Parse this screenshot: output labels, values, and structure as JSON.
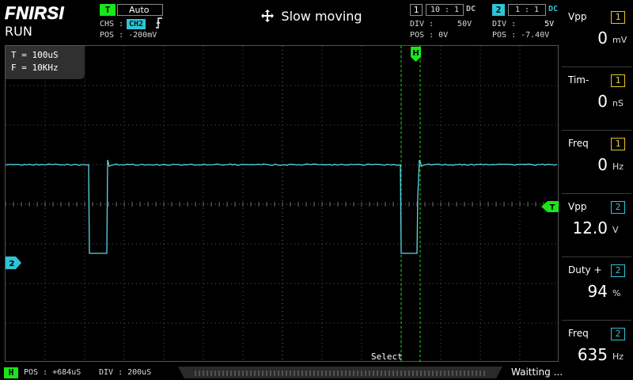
{
  "header": {
    "brand": "FNIRSI",
    "run_state": "RUN",
    "mode_text": "Slow moving"
  },
  "trigger": {
    "chip": "T",
    "mode": "Auto",
    "chs_label": "CHS :",
    "chs_value": "CH2",
    "pos_label": "POS : ",
    "pos_value": "-200mV"
  },
  "ch1": {
    "num": "1",
    "probe": "10 : 1",
    "coupling": "DC",
    "div_label": "DIV :",
    "div_value": "50V",
    "pos_label": "POS : ",
    "pos_value": "0V"
  },
  "ch2": {
    "num": "2",
    "probe": "1 : 1",
    "coupling": "DC",
    "div_label": "DIV :",
    "div_value": "5V",
    "pos_label": "POS : ",
    "pos_value": "-7.40V"
  },
  "screen": {
    "period": "T = 100uS",
    "freq": "F = 10KHz",
    "select": "Select",
    "h_marker": "H",
    "t_marker": "T",
    "ch2_marker": "2"
  },
  "measurements": [
    {
      "name": "Vpp",
      "ch": "1",
      "value": "0",
      "unit": "mV"
    },
    {
      "name": "Tim-",
      "ch": "1",
      "value": "0",
      "unit": "nS"
    },
    {
      "name": "Freq",
      "ch": "1",
      "value": "0",
      "unit": "Hz"
    },
    {
      "name": "Vpp",
      "ch": "2",
      "value": "12.0",
      "unit": "V"
    },
    {
      "name": "Duty +",
      "ch": "2",
      "value": "94",
      "unit": "%"
    },
    {
      "name": "Freq",
      "ch": "2",
      "value": "635",
      "unit": "Hz"
    }
  ],
  "footer": {
    "h_chip": "H",
    "pos_label": "POS : ",
    "pos_value": "+684uS",
    "div_label": "DIV : ",
    "div_value": "200uS",
    "status": "Waitting ..."
  },
  "colors": {
    "ch1": "#e6c619",
    "ch2": "#2ec4d6",
    "trigger": "#19e619",
    "trace": "#5ad8e6"
  },
  "icons": {
    "move": "four-arrow-move-icon",
    "edge": "rising-edge-icon"
  }
}
